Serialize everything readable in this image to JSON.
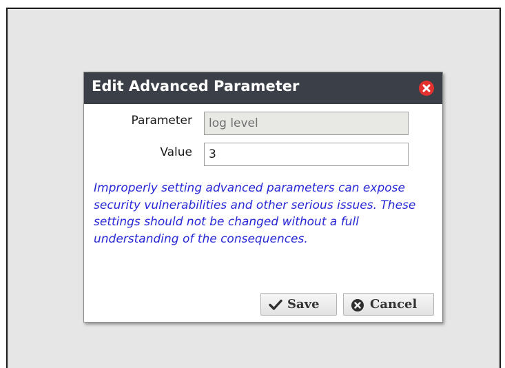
{
  "dialog": {
    "title": "Edit Advanced Parameter",
    "close_icon": "close-circle-icon",
    "fields": {
      "parameter_label": "Parameter",
      "parameter_value": "log level",
      "value_label": "Value",
      "value_value": "3"
    },
    "warning": "Improperly setting advanced parameters can expose security vulnerabilities and other serious issues. These settings should not be changed without a full understanding of the consequences.",
    "buttons": {
      "save_label": "Save",
      "save_icon": "check-icon",
      "cancel_label": "Cancel",
      "cancel_icon": "cancel-circle-icon"
    }
  },
  "colors": {
    "titlebar": "#3b4048",
    "close": "#e4312f",
    "warning_text": "#2828d6",
    "backdrop": "#e6e6e6"
  }
}
